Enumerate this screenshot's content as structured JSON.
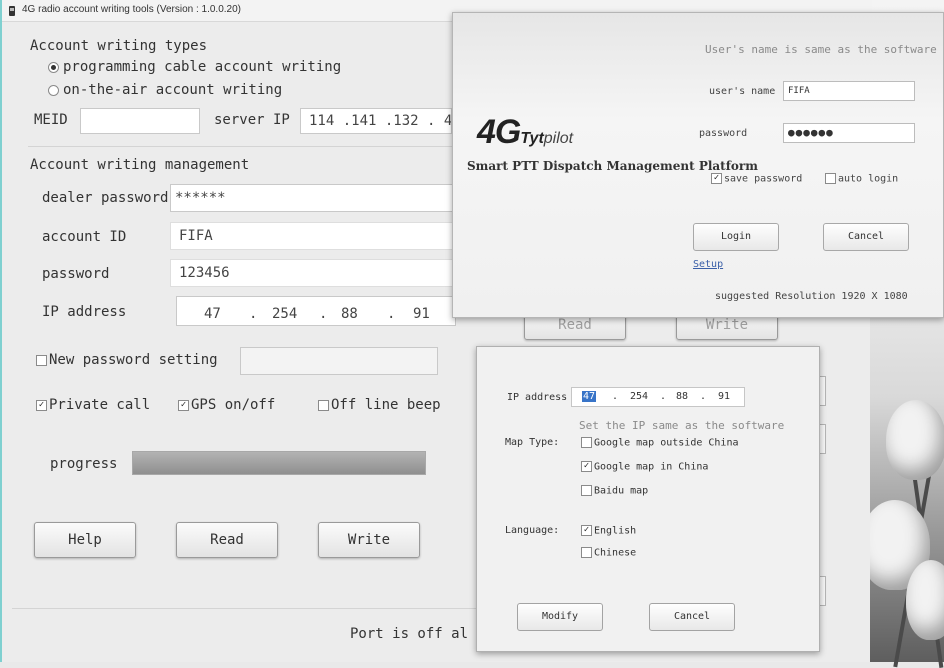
{
  "window": {
    "title": "4G radio account writing tools (Version : 1.0.0.20)"
  },
  "writing_types": {
    "heading": "Account writing types",
    "options": [
      {
        "label": "programming cable account writing",
        "selected": true
      },
      {
        "label": "on-the-air account writing",
        "selected": false
      }
    ]
  },
  "meid": {
    "label": "MEID",
    "value": ""
  },
  "server_ip": {
    "label": "server IP",
    "value": "114 .141 .132 . 4"
  },
  "management": {
    "heading": "Account writing management",
    "dealer_password": {
      "label": "dealer password",
      "value": "******"
    },
    "account_id": {
      "label": "account ID",
      "value": "FIFA"
    },
    "password": {
      "label": "password",
      "value": "123456"
    },
    "ip_address": {
      "label": "IP address",
      "segments": [
        "47",
        "254",
        "88",
        "91"
      ],
      "dot": "."
    }
  },
  "new_password": {
    "label": "New password setting",
    "checked": false,
    "value": ""
  },
  "options": {
    "private_call": {
      "label": "Private call",
      "checked": true
    },
    "gps": {
      "label": "GPS on/off",
      "checked": true
    },
    "offline_beep": {
      "label": "Off line beep",
      "checked": false
    }
  },
  "progress": {
    "label": "progress",
    "value": 1.0
  },
  "buttons": {
    "help": "Help",
    "read": "Read",
    "write": "Write"
  },
  "status": {
    "text": "Port is off al"
  },
  "background_buttons": {
    "read": "Read",
    "write": "Write"
  },
  "login": {
    "logo_4g": "4G",
    "logo_brand": "Tyt",
    "logo_brand2": "pilot",
    "subtitle": "Smart PTT Dispatch Management Platform",
    "hint": "User's name is same as the software",
    "username": {
      "label": "user's name",
      "value": "FIFA"
    },
    "password": {
      "label": "password",
      "value": "●●●●●●"
    },
    "save_password": {
      "label": "save password",
      "checked": true
    },
    "auto_login": {
      "label": "auto login",
      "checked": false
    },
    "login_button": "Login",
    "cancel_button": "Cancel",
    "setup_link": "Setup",
    "resolution": "suggested Resolution 1920 X 1080"
  },
  "map_dialog": {
    "ip_label": "IP address",
    "ip_segments": [
      "47",
      "254",
      "88",
      "91"
    ],
    "ip_dot": ".",
    "ip_hint": "Set the IP same as the software",
    "map_type_label": "Map Type:",
    "map_options": [
      {
        "label": "Google map outside China",
        "checked": false
      },
      {
        "label": "Google map in China",
        "checked": true
      },
      {
        "label": "Baidu map",
        "checked": false
      }
    ],
    "language_label": "Language:",
    "languages": [
      {
        "label": "English",
        "checked": true
      },
      {
        "label": "Chinese",
        "checked": false
      }
    ],
    "modify_button": "Modify",
    "cancel_button": "Cancel"
  },
  "colors": {
    "accent": "#7fd0d0",
    "progress": "#9a9a9a",
    "link": "#3a5fa8"
  }
}
